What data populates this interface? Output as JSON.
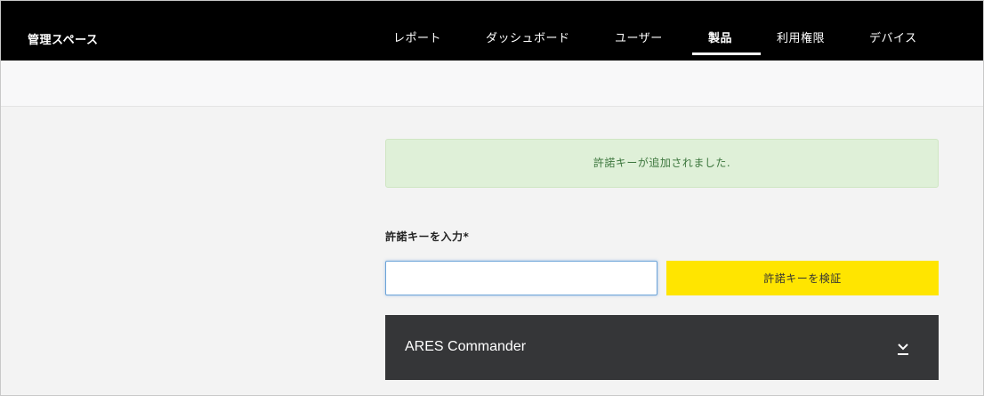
{
  "header": {
    "brand": "管理スペース",
    "nav": [
      {
        "label": "レポート",
        "active": false
      },
      {
        "label": "ダッシュボード",
        "active": false
      },
      {
        "label": "ユーザー",
        "active": false
      },
      {
        "label": "製品",
        "active": true
      },
      {
        "label": "利用権限",
        "active": false
      },
      {
        "label": "デバイス",
        "active": false
      }
    ]
  },
  "alert": {
    "message": "許諾キーが追加されました.",
    "color": "#3c763d",
    "background": "#dff0d8"
  },
  "license_form": {
    "label": "許諾キーを入力*",
    "input_value": "",
    "input_placeholder": "",
    "verify_label": "許諾キーを検証",
    "button_color": "#ffe500"
  },
  "product": {
    "name": "ARES Commander",
    "expand_icon": "chevron-down-icon"
  }
}
